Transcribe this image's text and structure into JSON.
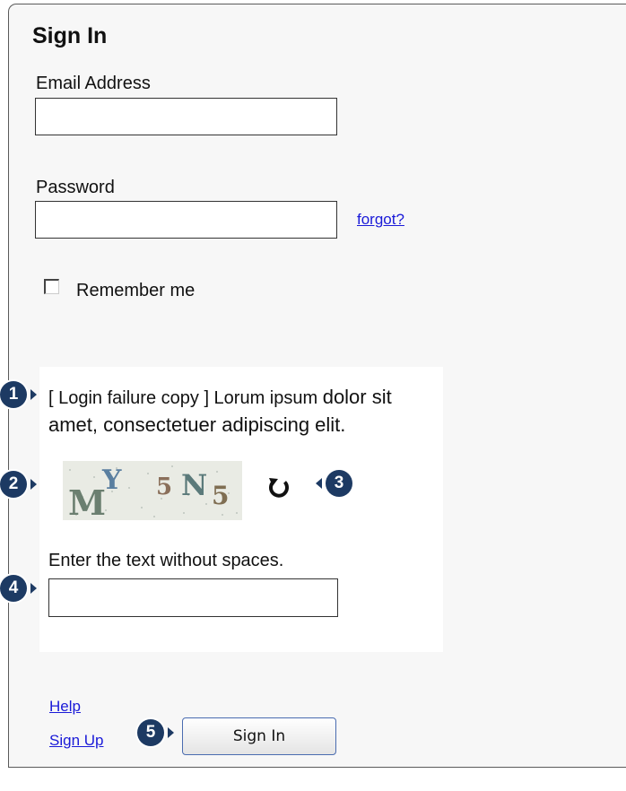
{
  "form": {
    "title": "Sign In",
    "email": {
      "label": "Email Address",
      "value": "",
      "placeholder": ""
    },
    "password": {
      "label": "Password",
      "value": "",
      "placeholder": ""
    },
    "forgot_link": "forgot?",
    "remember": {
      "label": "Remember me",
      "checked": false
    }
  },
  "error": {
    "text_part1": "[ Login failure copy ] Lorum ipsum ",
    "text_part2": "dolor",
    "text_part3": " sit amet, consectetuer adipiscing elit."
  },
  "captcha": {
    "image_text": [
      "M",
      "Y",
      "5",
      "N",
      "5"
    ],
    "refresh_icon": "refresh-icon",
    "instruction": "Enter the text without spaces.",
    "value": ""
  },
  "footer": {
    "help_link": "Help",
    "signup_link": "Sign Up",
    "signin_button": "Sign In"
  },
  "annotations": [
    "1",
    "2",
    "3",
    "4",
    "5"
  ],
  "colors": {
    "marker": "#1d3a63",
    "link": "#1a1ad8",
    "panel_bg": "#f7f7f7",
    "button_border": "#4a6cb0"
  }
}
